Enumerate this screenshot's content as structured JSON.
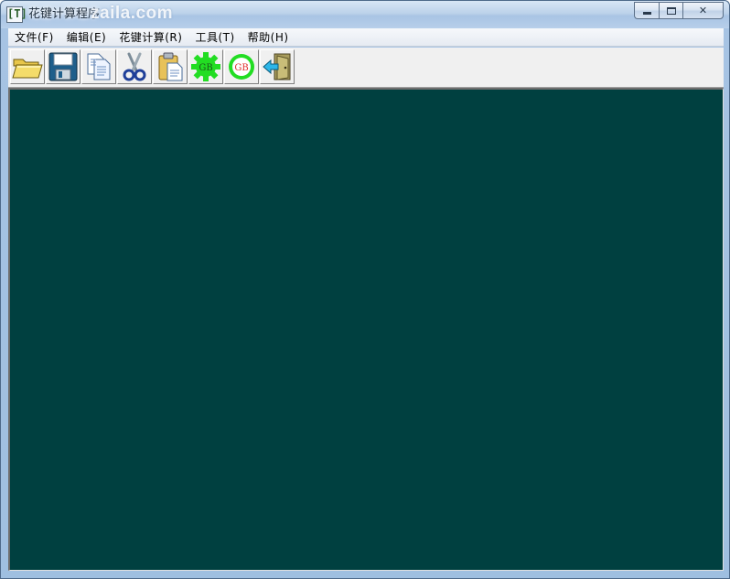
{
  "window": {
    "title": "花键计算程序",
    "watermark": "zaila.com",
    "app_icon_glyph": "[T]"
  },
  "caption": {
    "close_glyph": "✕"
  },
  "menu": {
    "items": [
      {
        "label": "文件(F)"
      },
      {
        "label": "编辑(E)"
      },
      {
        "label": "花键计算(R)"
      },
      {
        "label": "工具(T)"
      },
      {
        "label": "帮助(H)"
      }
    ]
  },
  "toolbar": {
    "gb_label": "GB",
    "buttons": [
      {
        "icon": "open-folder-icon"
      },
      {
        "icon": "save-disk-icon"
      },
      {
        "icon": "copy-icon"
      },
      {
        "icon": "cut-icon"
      },
      {
        "icon": "paste-icon"
      },
      {
        "icon": "gb-gear-green-icon"
      },
      {
        "icon": "gb-gear-red-icon"
      },
      {
        "icon": "exit-door-icon"
      }
    ]
  },
  "colors": {
    "client_background": "#004040",
    "gb_green": "#22dd22",
    "gb_red": "#e03030"
  }
}
